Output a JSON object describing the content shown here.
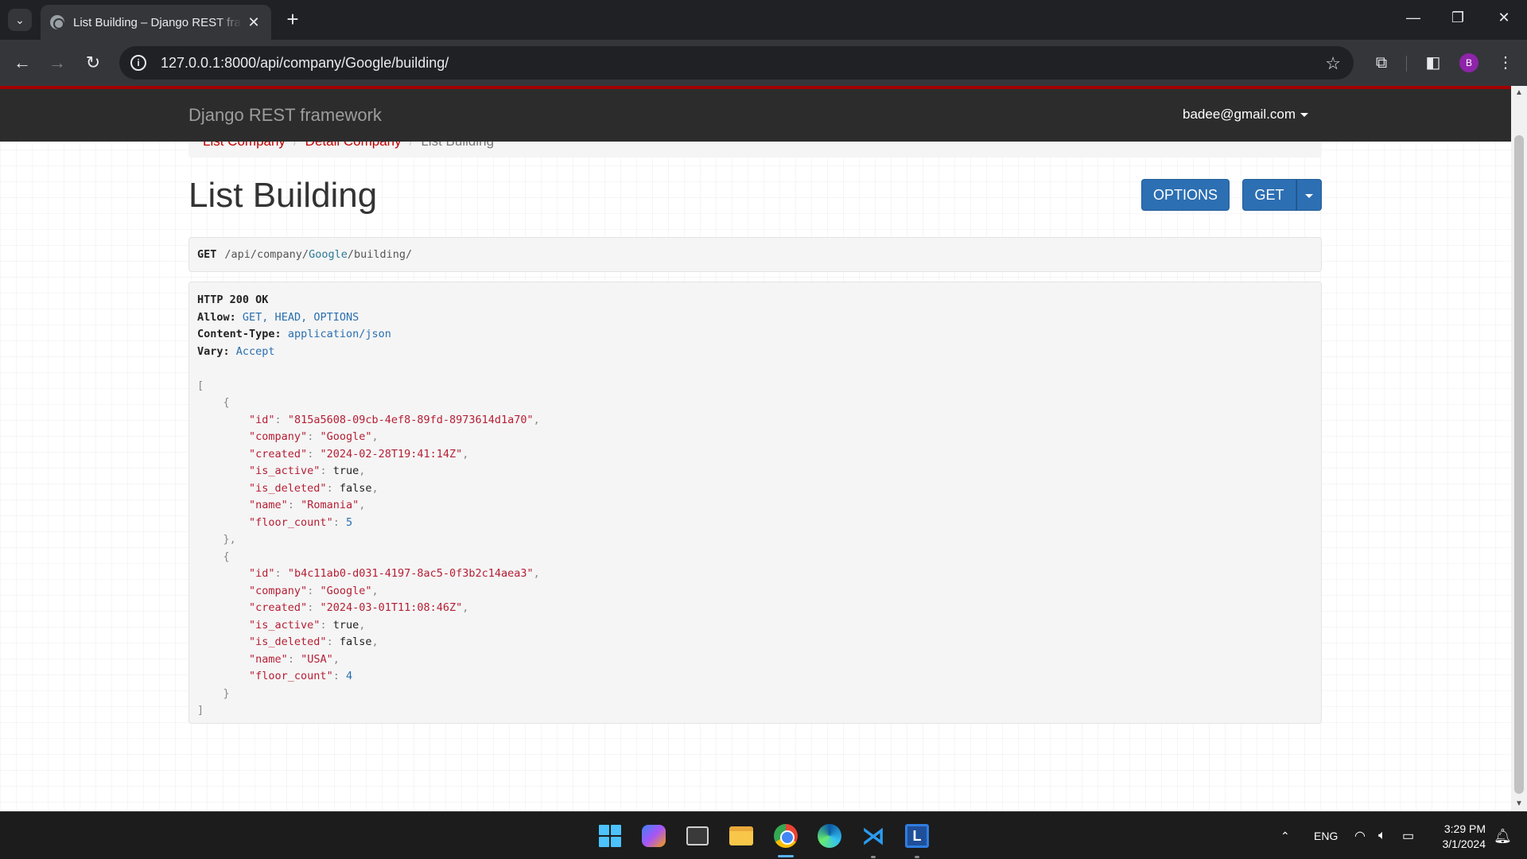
{
  "browser": {
    "tab_title": "List Building – Django REST framework",
    "url": "127.0.0.1:8000/api/company/Google/building/",
    "profile_initial": "B"
  },
  "navbar": {
    "brand": "Django REST framework",
    "user": "badee@gmail.com"
  },
  "breadcrumbs": [
    "List Company",
    "Detail Company",
    "List Building"
  ],
  "page": {
    "title": "List Building",
    "options_label": "OPTIONS",
    "get_label": "GET"
  },
  "request": {
    "method": "GET",
    "path_prefix": "/api/company/",
    "path_param": "Google",
    "path_suffix": "/building/"
  },
  "response": {
    "status": "HTTP 200 OK",
    "headers": [
      {
        "key": "Allow:",
        "value": "GET, HEAD, OPTIONS"
      },
      {
        "key": "Content-Type:",
        "value": "application/json"
      },
      {
        "key": "Vary:",
        "value": "Accept"
      }
    ],
    "items": [
      {
        "id": "\"815a5608-09cb-4ef8-89fd-8973614d1a70\"",
        "company": "\"Google\"",
        "created": "\"2024-02-28T19:41:14Z\"",
        "is_active": "true",
        "is_deleted": "false",
        "name": "\"Romania\"",
        "floor_count": "5"
      },
      {
        "id": "\"b4c11ab0-d031-4197-8ac5-0f3b2c14aea3\"",
        "company": "\"Google\"",
        "created": "\"2024-03-01T11:08:46Z\"",
        "is_active": "true",
        "is_deleted": "false",
        "name": "\"USA\"",
        "floor_count": "4"
      }
    ]
  },
  "taskbar": {
    "lang": "ENG",
    "time": "3:29 PM",
    "date": "3/1/2024"
  },
  "colors": {
    "navbar": "#2c2c2c",
    "navbar_accent": "#a30000",
    "button": "#2c6fb3",
    "link": "#c20000"
  }
}
